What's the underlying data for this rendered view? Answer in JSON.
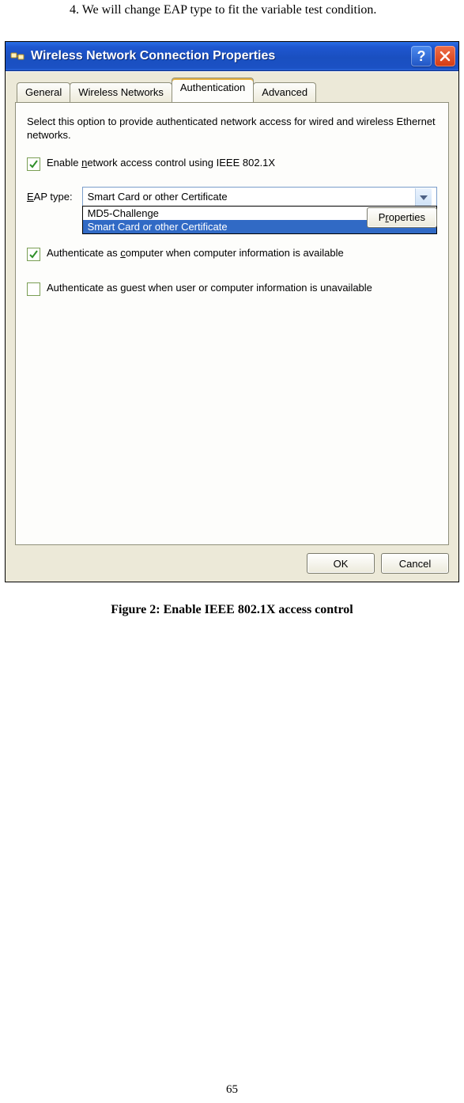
{
  "doc": {
    "instruction": "4. We will change EAP type to fit the variable test condition.",
    "caption": "Figure 2: Enable IEEE 802.1X access control",
    "page_number": "65"
  },
  "window": {
    "title": "Wireless Network Connection Properties",
    "help_btn": "?",
    "tabs": {
      "general": "General",
      "wireless": "Wireless Networks",
      "authentication": "Authentication",
      "advanced": "Advanced"
    },
    "panel": {
      "description": "Select this option to provide authenticated network access for wired and wireless Ethernet networks.",
      "enable_prefix": "Enable ",
      "enable_u": "n",
      "enable_suffix": "etwork access control using IEEE 802.1X",
      "eap_label_u": "E",
      "eap_label_rest": "AP type:",
      "eap_selected": "Smart Card or other Certificate",
      "eap_options": {
        "a": "MD5-Challenge",
        "b": "Smart Card or other Certificate"
      },
      "properties_btn_prefix": "P",
      "properties_btn_u": "r",
      "properties_btn_suffix": "operties",
      "auth_comp_prefix": "Authenticate as ",
      "auth_comp_u": "c",
      "auth_comp_suffix": "omputer when computer information is available",
      "auth_guest_prefix": "Authenticate as ",
      "auth_guest_u": "g",
      "auth_guest_suffix": "uest when user or computer information is unavailable"
    },
    "buttons": {
      "ok": "OK",
      "cancel": "Cancel"
    }
  }
}
